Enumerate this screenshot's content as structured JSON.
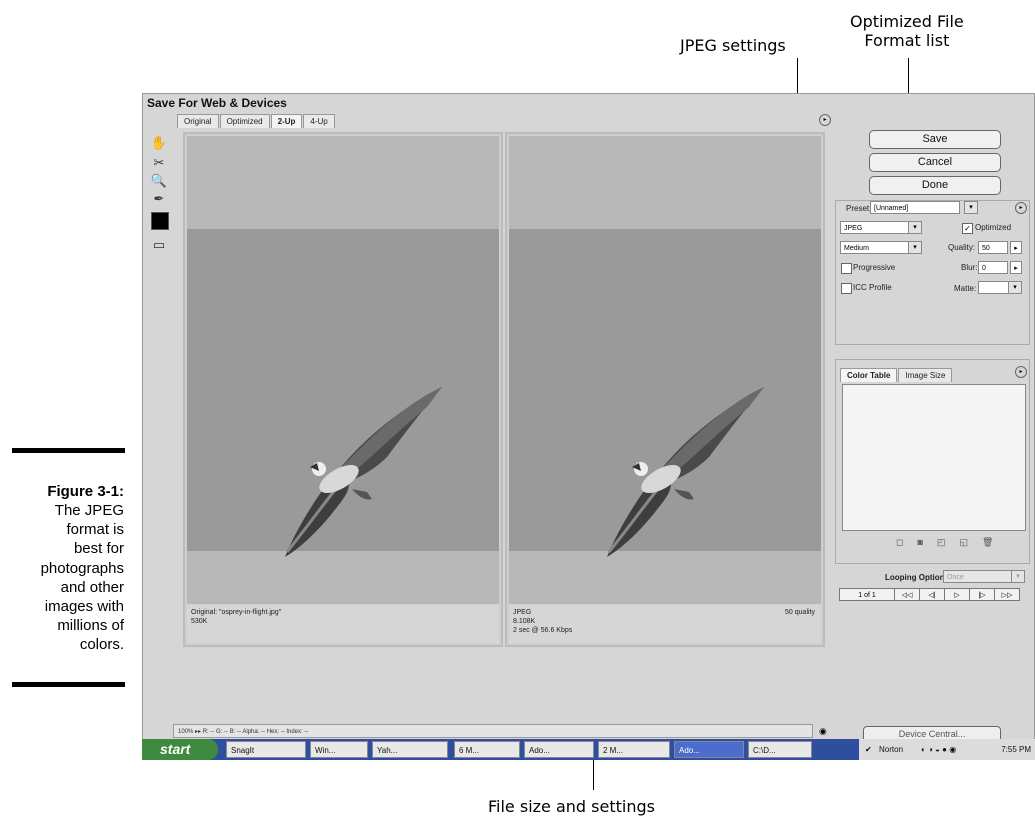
{
  "callouts": {
    "jpeg_settings": "JPEG settings",
    "format_list": "Optimized File\nFormat list",
    "file_size": "File size and settings"
  },
  "caption": {
    "label": "Figure 3-1:",
    "text": "The JPEG\nformat is\nbest for\nphotographs\nand other\nimages with\nmillions of\ncolors."
  },
  "dialog": {
    "title": "Save For Web & Devices",
    "tabs": [
      "Original",
      "Optimized",
      "2-Up",
      "4-Up"
    ],
    "active_tab": "2-Up",
    "left_info": [
      "Original: \"osprey-in-flight.jpg\"",
      "530K"
    ],
    "right_info": [
      "JPEG",
      "8.108K",
      "2 sec @ 56.6 Kbps"
    ],
    "right_quality": "50 quality",
    "buttons": {
      "save": "Save",
      "cancel": "Cancel",
      "done": "Done"
    },
    "settings": {
      "preset_label": "Preset:",
      "preset_value": "[Unnamed]",
      "format": "JPEG",
      "optimized_label": "Optimized",
      "compression": "Medium",
      "quality_label": "Quality:",
      "quality_value": "50",
      "progressive_label": "Progressive",
      "blur_label": "Blur:",
      "blur_value": "0",
      "icc_label": "ICC Profile",
      "matte_label": "Matte:"
    },
    "panel_tabs": [
      "Color Table",
      "Image Size"
    ],
    "looping_label": "Looping Options:",
    "looping_value": "Once",
    "pager": [
      "1 of 1",
      "◁◁",
      "◁|",
      "▷",
      "|▷",
      "▷▷"
    ],
    "status": "100%  ▸▸  R: --  G: --  B: --  Alpha: --  Hex: --  Index: --",
    "device_central": "Device Central..."
  },
  "taskbar": {
    "start": "start",
    "items": [
      "SnagIt",
      "Win...",
      "Yah...",
      "6 M...",
      "Ado...",
      "2 M...",
      "Ado...",
      "C:\\D..."
    ],
    "active_index": 6,
    "tray_app": "Norton",
    "clock": "7:55 PM"
  }
}
